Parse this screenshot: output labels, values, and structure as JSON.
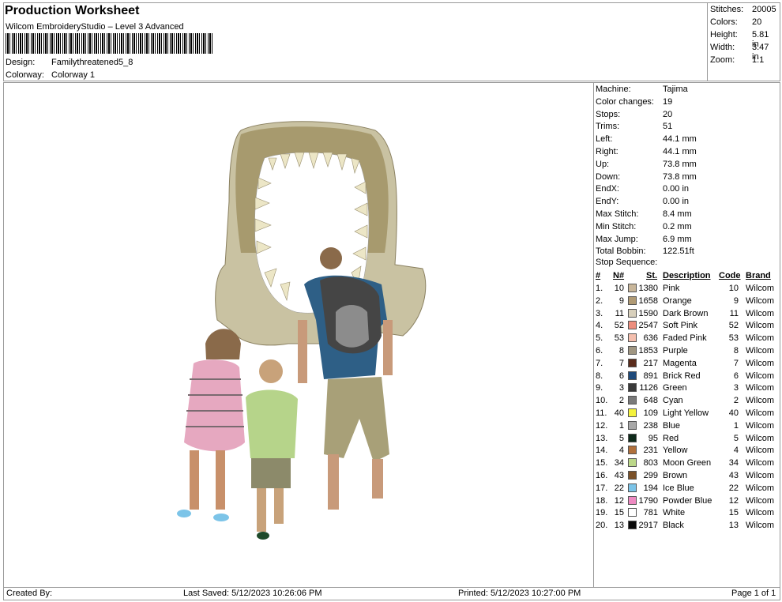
{
  "header": {
    "title": "Production Worksheet",
    "software": "Wilcom EmbroideryStudio – Level 3 Advanced",
    "design_label": "Design:",
    "design_value": "Familythreatened5_8",
    "colorway_label": "Colorway:",
    "colorway_value": "Colorway 1"
  },
  "summary": [
    {
      "label": "Stitches:",
      "value": "20005"
    },
    {
      "label": "Colors:",
      "value": "20"
    },
    {
      "label": "Height:",
      "value": "5.81 in"
    },
    {
      "label": "Width:",
      "value": "3.47 in"
    },
    {
      "label": "Zoom:",
      "value": "1:1"
    }
  ],
  "machine_info": [
    {
      "label": "Machine:",
      "value": "Tajima"
    },
    {
      "label": "Color changes:",
      "value": "19"
    },
    {
      "label": "Stops:",
      "value": "20"
    },
    {
      "label": "Trims:",
      "value": "51"
    },
    {
      "label": "Left:",
      "value": "44.1 mm"
    },
    {
      "label": "Right:",
      "value": "44.1 mm"
    },
    {
      "label": "Up:",
      "value": "73.8 mm"
    },
    {
      "label": "Down:",
      "value": "73.8 mm"
    },
    {
      "label": "EndX:",
      "value": "0.00 in"
    },
    {
      "label": "EndY:",
      "value": "0.00 in"
    },
    {
      "label": "Max Stitch:",
      "value": "8.4 mm"
    },
    {
      "label": "Min Stitch:",
      "value": "0.2 mm"
    },
    {
      "label": "Max Jump:",
      "value": "6.9 mm"
    },
    {
      "label": "Total Bobbin:",
      "value": "122.51ft"
    }
  ],
  "stop_sequence": {
    "title": "Stop Sequence:",
    "headers": {
      "num": "#",
      "n": "N#",
      "st": "St.",
      "desc": "Description",
      "code": "Code",
      "brand": "Brand"
    },
    "rows": [
      {
        "num": "1.",
        "n": "10",
        "color": "#c8b69a",
        "st": "1380",
        "desc": "Pink",
        "code": "10",
        "brand": "Wilcom"
      },
      {
        "num": "2.",
        "n": "9",
        "color": "#b09a74",
        "st": "1658",
        "desc": "Orange",
        "code": "9",
        "brand": "Wilcom"
      },
      {
        "num": "3.",
        "n": "11",
        "color": "#d8d0bc",
        "st": "1590",
        "desc": "Dark Brown",
        "code": "11",
        "brand": "Wilcom"
      },
      {
        "num": "4.",
        "n": "52",
        "color": "#ec8e7e",
        "st": "2547",
        "desc": "Soft Pink",
        "code": "52",
        "brand": "Wilcom"
      },
      {
        "num": "5.",
        "n": "53",
        "color": "#f4bfae",
        "st": "636",
        "desc": "Faded Pink",
        "code": "53",
        "brand": "Wilcom"
      },
      {
        "num": "6.",
        "n": "8",
        "color": "#a09682",
        "st": "1853",
        "desc": "Purple",
        "code": "8",
        "brand": "Wilcom"
      },
      {
        "num": "7.",
        "n": "7",
        "color": "#5a2c1c",
        "st": "217",
        "desc": "Magenta",
        "code": "7",
        "brand": "Wilcom"
      },
      {
        "num": "8.",
        "n": "6",
        "color": "#1e4a7a",
        "st": "891",
        "desc": "Brick Red",
        "code": "6",
        "brand": "Wilcom"
      },
      {
        "num": "9.",
        "n": "3",
        "color": "#3a3a3a",
        "st": "1126",
        "desc": "Green",
        "code": "3",
        "brand": "Wilcom"
      },
      {
        "num": "10.",
        "n": "2",
        "color": "#7a7a7a",
        "st": "648",
        "desc": "Cyan",
        "code": "2",
        "brand": "Wilcom"
      },
      {
        "num": "11.",
        "n": "40",
        "color": "#f4f23c",
        "st": "109",
        "desc": "Light Yellow",
        "code": "40",
        "brand": "Wilcom"
      },
      {
        "num": "12.",
        "n": "1",
        "color": "#a8a8a8",
        "st": "238",
        "desc": "Blue",
        "code": "1",
        "brand": "Wilcom"
      },
      {
        "num": "13.",
        "n": "5",
        "color": "#0e2a1a",
        "st": "95",
        "desc": "Red",
        "code": "5",
        "brand": "Wilcom"
      },
      {
        "num": "14.",
        "n": "4",
        "color": "#b0703c",
        "st": "231",
        "desc": "Yellow",
        "code": "4",
        "brand": "Wilcom"
      },
      {
        "num": "15.",
        "n": "34",
        "color": "#bcd88a",
        "st": "803",
        "desc": "Moon Green",
        "code": "34",
        "brand": "Wilcom"
      },
      {
        "num": "16.",
        "n": "43",
        "color": "#7a5028",
        "st": "299",
        "desc": "Brown",
        "code": "43",
        "brand": "Wilcom"
      },
      {
        "num": "17.",
        "n": "22",
        "color": "#7cc4e8",
        "st": "194",
        "desc": "Ice Blue",
        "code": "22",
        "brand": "Wilcom"
      },
      {
        "num": "18.",
        "n": "12",
        "color": "#ee8ac2",
        "st": "1790",
        "desc": "Powder Blue",
        "code": "12",
        "brand": "Wilcom"
      },
      {
        "num": "19.",
        "n": "15",
        "color": "#ffffff",
        "st": "781",
        "desc": "White",
        "code": "15",
        "brand": "Wilcom"
      },
      {
        "num": "20.",
        "n": "13",
        "color": "#0a0a0a",
        "st": "2917",
        "desc": "Black",
        "code": "13",
        "brand": "Wilcom"
      }
    ]
  },
  "footer": {
    "created": "Created By:",
    "saved": "Last Saved: 5/12/2023 10:26:06 PM",
    "printed": "Printed: 5/12/2023 10:27:00 PM",
    "page": "Page 1 of 1"
  }
}
